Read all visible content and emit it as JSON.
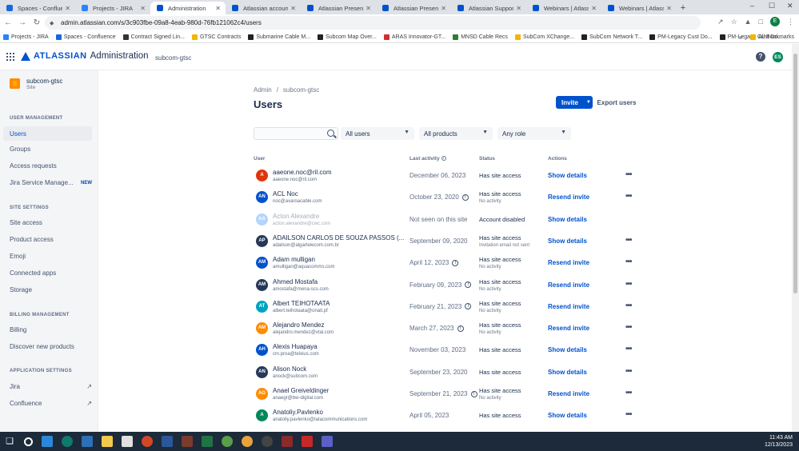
{
  "browser": {
    "tabs": [
      {
        "title": "Spaces - Confluence",
        "color": "#1868db"
      },
      {
        "title": "Projects - JIRA",
        "color": "#2684ff"
      },
      {
        "title": "Administration",
        "color": "#0052cc",
        "active": true
      },
      {
        "title": "Atlassian account",
        "color": "#0052cc"
      },
      {
        "title": "Atlassian Presents: U",
        "color": "#0052cc"
      },
      {
        "title": "Atlassian Presents: U",
        "color": "#0052cc"
      },
      {
        "title": "Atlassian Support: Cl",
        "color": "#0052cc"
      },
      {
        "title": "Webinars | Atlassian",
        "color": "#0052cc"
      },
      {
        "title": "Webinars | Atlassian",
        "color": "#0052cc"
      }
    ],
    "url": "admin.atlassian.com/s/3c903fbe-09a8-4eab-980d-76fb121062c4/users",
    "profile_initial": "E",
    "bookmarks": [
      {
        "label": "Projects - JIRA",
        "color": "#2684ff"
      },
      {
        "label": "Spaces - Confluence",
        "color": "#1868db"
      },
      {
        "label": "Contract Signed Lin...",
        "color": "#333333"
      },
      {
        "label": "GTSC Contracts",
        "color": "#f4b400"
      },
      {
        "label": "Submarine Cable M...",
        "color": "#222222"
      },
      {
        "label": "Subcom Map Over...",
        "color": "#222222"
      },
      {
        "label": "ARAS Innovator-GT...",
        "color": "#d32f2f"
      },
      {
        "label": "MNSD Cable Recs",
        "color": "#2e7d32"
      },
      {
        "label": "SubCom XChange...",
        "color": "#f4b400"
      },
      {
        "label": "SubCom Network T...",
        "color": "#222222"
      },
      {
        "label": "PM-Legacy Cust Do...",
        "color": "#222222"
      },
      {
        "label": "PM-Legacy Cust Do...",
        "color": "#222222"
      }
    ],
    "all_bookmarks": "All Bookmarks"
  },
  "header": {
    "logo_text": "ATLASSIAN",
    "product": "Administration",
    "org": "subcom-gtsc",
    "help": "?",
    "user_initials": "ES"
  },
  "sidebar": {
    "site_name": "subcom-gtsc",
    "site_type": "Site",
    "user_management_title": "USER MANAGEMENT",
    "user_management": [
      {
        "label": "Users"
      },
      {
        "label": "Groups"
      },
      {
        "label": "Access requests"
      },
      {
        "label": "Jira Service Manage...",
        "badge": "NEW"
      }
    ],
    "site_settings_title": "SITE SETTINGS",
    "site_settings": [
      {
        "label": "Site access"
      },
      {
        "label": "Product access"
      },
      {
        "label": "Emoji"
      },
      {
        "label": "Connected apps"
      },
      {
        "label": "Storage"
      }
    ],
    "billing_title": "BILLING MANAGEMENT",
    "billing": [
      {
        "label": "Billing"
      },
      {
        "label": "Discover new products"
      }
    ],
    "app_settings_title": "APPLICATION SETTINGS",
    "app_settings": [
      {
        "label": "Jira"
      },
      {
        "label": "Confluence"
      }
    ]
  },
  "main": {
    "breadcrumb": [
      "Admin",
      "/",
      "subcom-gtsc"
    ],
    "title": "Users",
    "invite_label": "Invite",
    "export_label": "Export users",
    "search_placeholder": "",
    "filters": [
      "All users",
      "All products",
      "Any role"
    ],
    "columns": {
      "user": "User",
      "last_activity": "Last activity",
      "status": "Status",
      "actions": "Actions"
    },
    "users": [
      {
        "initials": "A",
        "color": "#de350b",
        "name": "aaeone.noc@ril.com",
        "email": "aaeone.noc@ril.com",
        "activity": "December 06, 2023",
        "status": "Has site access",
        "substatus": "",
        "action": "Show details",
        "more": true
      },
      {
        "initials": "AN",
        "color": "#0052cc",
        "name": "ACL Noc",
        "email": "noc@avaroacable.com",
        "activity": "October 23, 2020",
        "activity_icon": true,
        "status": "Has site access",
        "substatus": "No activity",
        "action": "Resend invite",
        "more": true
      },
      {
        "initials": "AA",
        "color": "#b3d4ff",
        "name": "Acton Alexandre",
        "email": "acton.alexandre@cwc.com",
        "activity": "Not seen on this site",
        "status": "Account disabled",
        "substatus": "",
        "action": "Show details",
        "more": false,
        "disabled": true
      },
      {
        "initials": "AP",
        "color": "#253858",
        "name": "ADAILSON CARLOS DE SOUZA PASSOS (...",
        "email": "adailson@algartelecom.com.br",
        "activity": "September 09, 2020",
        "status": "Has site access",
        "substatus": "Invitation email not sent",
        "action": "Show details",
        "more": true
      },
      {
        "initials": "AM",
        "color": "#0052cc",
        "name": "Adam mulligan",
        "email": "amulligan@aquacomms.com",
        "activity": "April 12, 2023",
        "activity_icon": true,
        "status": "Has site access",
        "substatus": "No activity",
        "action": "Resend invite",
        "more": true
      },
      {
        "initials": "AM",
        "color": "#253858",
        "name": "Ahmed Mostafa",
        "email": "amostafa@mena-scs.com",
        "activity": "February 09, 2023",
        "activity_icon": true,
        "status": "Has site access",
        "substatus": "No activity",
        "action": "Resend invite",
        "more": true
      },
      {
        "initials": "AT",
        "color": "#00a3bf",
        "name": "Albert TEIHOTAATA",
        "email": "albert.teihotaata@onati.pf",
        "activity": "February 21, 2023",
        "activity_icon": true,
        "status": "Has site access",
        "substatus": "No activity",
        "action": "Resend invite",
        "more": true
      },
      {
        "initials": "AM",
        "color": "#ff8b00",
        "name": "Alejandro Mendez",
        "email": "alejandro.mendez@vtal.com",
        "activity": "March 27, 2023",
        "activity_icon": true,
        "status": "Has site access",
        "substatus": "No activity",
        "action": "Resend invite",
        "more": true
      },
      {
        "initials": "AH",
        "color": "#0052cc",
        "name": "Alexis Huapaya",
        "email": "cm.proa@telxius.com",
        "activity": "November 03, 2023",
        "status": "Has site access",
        "substatus": "",
        "action": "Show details",
        "more": true
      },
      {
        "initials": "AN",
        "color": "#253858",
        "name": "Alison Nock",
        "email": "anock@subcom.com",
        "activity": "September 23, 2020",
        "status": "Has site access",
        "substatus": "",
        "action": "Show details",
        "more": true
      },
      {
        "initials": "AG",
        "color": "#ff8b00",
        "name": "Anael Greiveldinger",
        "email": "anaegr@bw-digital.com",
        "activity": "September 21, 2023",
        "activity_icon": true,
        "status": "Has site access",
        "substatus": "No activity",
        "action": "Resend invite",
        "more": true
      },
      {
        "initials": "A",
        "color": "#00875a",
        "name": "Anatoliy.Pavlenko",
        "email": "anatoliy.pavlenko@tatacommunications.com",
        "activity": "April 05, 2023",
        "status": "Has site access",
        "substatus": "",
        "action": "Show details",
        "more": true
      }
    ]
  },
  "taskbar": {
    "time": "11:43 AM",
    "date": "12/13/2023"
  }
}
